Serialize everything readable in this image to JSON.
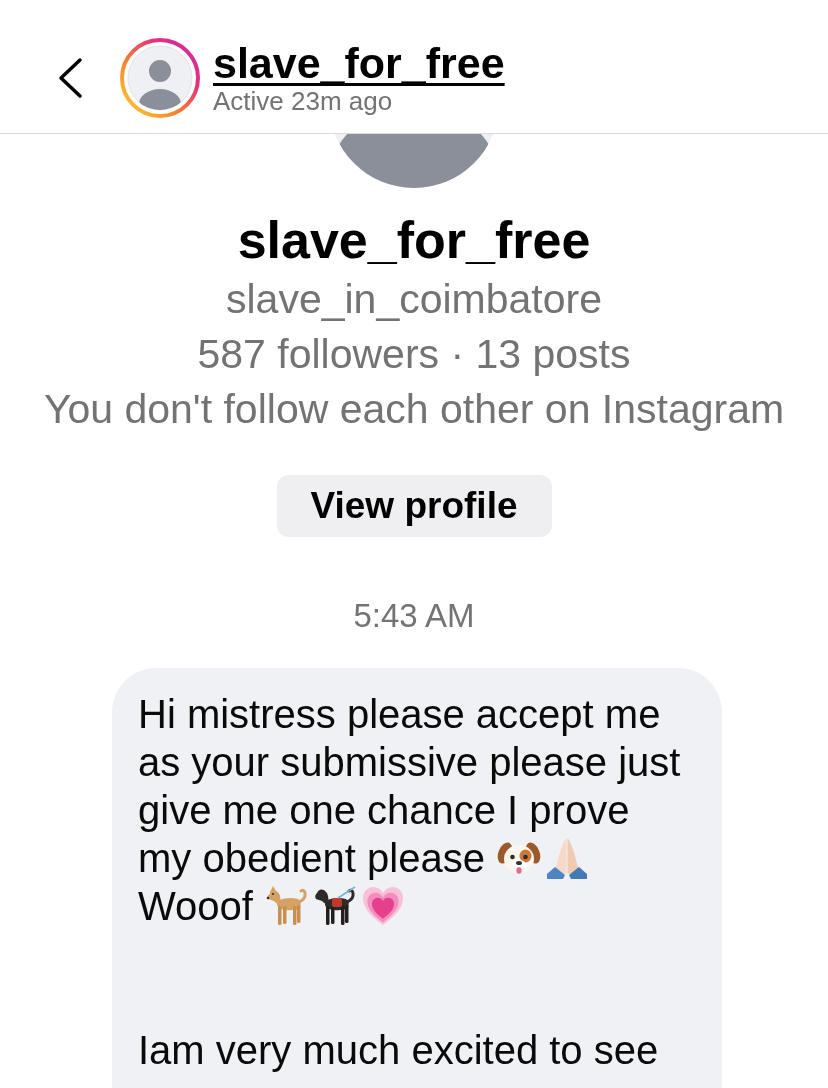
{
  "header": {
    "title": "slave_for_free",
    "status": "Active 23m ago",
    "story": true
  },
  "profile": {
    "name": "slave_for_free",
    "username": "slave_in_coimbatore",
    "stats": "587 followers · 13 posts",
    "relation": "You don't follow each other on Instagram",
    "button": "View profile"
  },
  "thread": {
    "time": "5:43 AM",
    "messages": [
      {
        "parts": [
          {
            "kind": "text",
            "text": "Hi mistress please accept me as your submissive please just give me one chance I prove"
          },
          {
            "kind": "break"
          },
          {
            "kind": "text",
            "text": "my obedient please"
          },
          {
            "kind": "dogface"
          },
          {
            "kind": "prayer"
          },
          {
            "kind": "break"
          },
          {
            "kind": "text",
            "text": "Wooof"
          },
          {
            "kind": "dog"
          },
          {
            "kind": "servicedog"
          },
          {
            "kind": "heart"
          },
          {
            "kind": "break"
          },
          {
            "kind": "break"
          },
          {
            "kind": "break"
          },
          {
            "kind": "text",
            "text": "Iam very much excited to see"
          }
        ]
      }
    ]
  }
}
